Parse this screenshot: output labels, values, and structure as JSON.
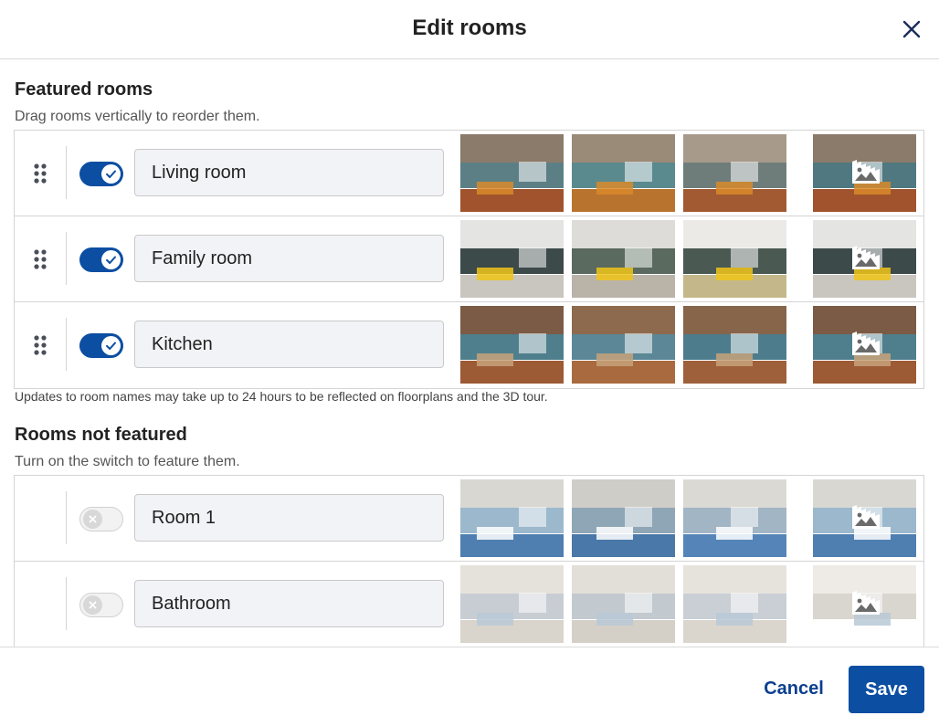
{
  "dialog": {
    "title": "Edit rooms",
    "close_icon": "close-icon"
  },
  "featured": {
    "title": "Featured rooms",
    "subtitle": "Drag rooms vertically to reorder them.",
    "note": "Updates to room names may take up to 24 hours to be reflected on floorplans and the 3D tour.",
    "rooms": [
      {
        "name": "Living room",
        "enabled": true,
        "palette": "living"
      },
      {
        "name": "Family room",
        "enabled": true,
        "palette": "family"
      },
      {
        "name": "Kitchen",
        "enabled": true,
        "palette": "kitchen"
      }
    ]
  },
  "not_featured": {
    "title": "Rooms not featured",
    "subtitle": "Turn on the switch to feature them.",
    "rooms": [
      {
        "name": "Room 1",
        "enabled": false,
        "palette": "bedroom"
      },
      {
        "name": "Bathroom",
        "enabled": false,
        "palette": "bathroom"
      }
    ]
  },
  "footer": {
    "cancel_label": "Cancel",
    "save_label": "Save"
  },
  "colors": {
    "accent": "#0b4ea2",
    "link": "#0b3f8f",
    "border": "#d4d4d4",
    "input_bg": "#f2f3f7"
  },
  "icons": {
    "drag": "drag-handle-icon",
    "toggle_on": "check-icon",
    "toggle_off": "x-icon",
    "cover": "cover-photo-icon"
  }
}
